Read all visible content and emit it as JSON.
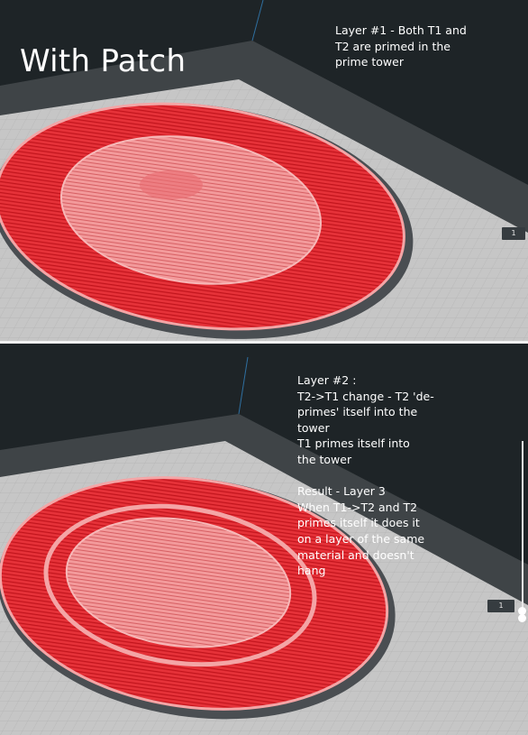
{
  "top_view": {
    "title": "With Patch",
    "annotation": [
      "Layer #1 - Both T1 and",
      "T2 are primed in the",
      "prime tower"
    ],
    "layer_number": "1"
  },
  "bottom_view": {
    "annotation": [
      "Layer #2 :",
      "T2->T1 change - T2 'de-",
      "primes' itself into the",
      "tower",
      "T1 primes itself into",
      "the tower",
      "",
      "Result - Layer 3",
      "When T1->T2 and T2",
      "primes itself it does it",
      "on a layer of the same",
      "material and doesn't",
      "hang"
    ],
    "layer_number": "1"
  },
  "colors": {
    "background": "#1e2427",
    "build_plate": "#c4c4c4",
    "print_red": "#e8272d",
    "print_highlight": "#f28f8f"
  }
}
